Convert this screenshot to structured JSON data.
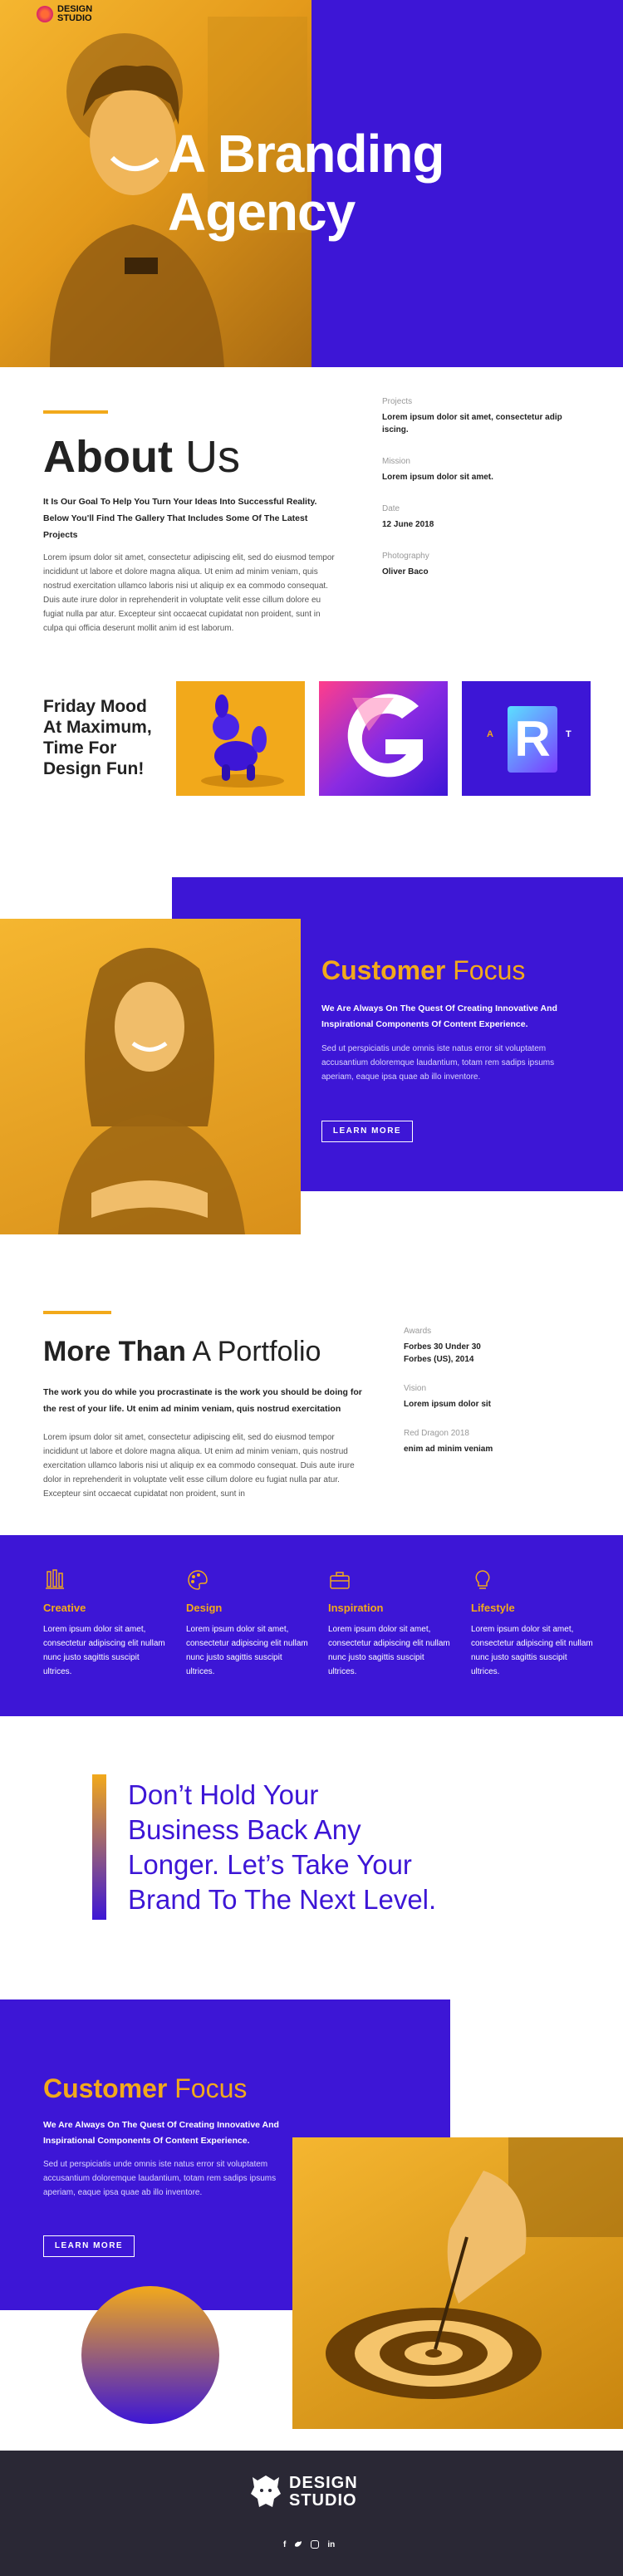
{
  "brand": {
    "name_line1": "DESIGN",
    "name_line2": "STUDIO"
  },
  "hero": {
    "title_line1": "A Branding",
    "title_line2": "Agency"
  },
  "about": {
    "title_bold": "About",
    "title_light": "Us",
    "lead": "It Is Our Goal To Help You Turn Your Ideas Into Successful Reality. Below You'll Find The Gallery That Includes Some Of The Latest Projects",
    "body": "Lorem ipsum dolor sit amet, consectetur adipiscing elit, sed do eiusmod tempor incididunt ut labore et dolore magna aliqua. Ut enim ad minim veniam, quis nostrud exercitation ullamco laboris nisi ut aliquip ex ea commodo consequat. Duis aute irure dolor in reprehenderit in voluptate velit esse cillum dolore eu fugiat nulla par atur. Excepteur sint occaecat cupidatat non proident, sunt in culpa qui officia deserunt mollit anim id est laborum.",
    "meta": [
      {
        "label": "Projects",
        "value": "Lorem ipsum dolor sit amet, consectetur adip iscing."
      },
      {
        "label": "Mission",
        "value": "Lorem ipsum dolor sit amet."
      },
      {
        "label": "Date",
        "value": "12 June 2018"
      },
      {
        "label": "Photography",
        "value": "Oliver Baco"
      }
    ]
  },
  "friday": {
    "text": "Friday Mood At Maximum, Time For Design Fun!",
    "tile_letters": [
      "A",
      "R",
      "T"
    ]
  },
  "customer_focus_1": {
    "title_orange": "Customer",
    "title_light": "Focus",
    "lead": "We Are Always On The Quest Of Creating Innovative And Inspirational Components Of Content Experience.",
    "body": "Sed ut perspiciatis unde omnis iste natus error sit voluptatem accusantium doloremque laudantium, totam rem sadips ipsums aperiam, eaque ipsa quae ab illo inventore.",
    "button": "LEARN MORE"
  },
  "portfolio": {
    "title_bold": "More Than",
    "title_light": "A Portfolio",
    "lead": "The work you do while you procrastinate is the work you should be doing for the rest of your life. Ut enim ad minim veniam, quis nostrud exercitation",
    "body": "Lorem ipsum dolor sit amet, consectetur adipiscing elit, sed do eiusmod tempor incididunt ut labore et dolore magna aliqua. Ut enim ad minim veniam, quis nostrud exercitation ullamco laboris nisi ut aliquip ex ea commodo consequat. Duis aute irure dolor in reprehenderit in voluptate velit esse cillum dolore eu fugiat nulla par atur. Excepteur sint occaecat cupidatat non proident, sunt in",
    "meta": [
      {
        "label": "Awards",
        "value": "Forbes 30 Under 30 Forbes (US), 2014"
      },
      {
        "label": "Vision",
        "value": "Lorem ipsum dolor sit"
      },
      {
        "label": "Red Dragon 2018",
        "value": "enim ad minim veniam"
      }
    ]
  },
  "services": [
    {
      "title": "Creative",
      "text": "Lorem ipsum dolor sit amet, consectetur adipiscing elit nullam nunc justo sagittis suscipit ultrices."
    },
    {
      "title": "Design",
      "text": "Lorem ipsum dolor sit amet, consectetur adipiscing elit nullam nunc justo sagittis suscipit ultrices."
    },
    {
      "title": "Inspiration",
      "text": "Lorem ipsum dolor sit amet, consectetur adipiscing elit nullam nunc justo sagittis suscipit ultrices."
    },
    {
      "title": "Lifestyle",
      "text": "Lorem ipsum dolor sit amet, consectetur adipiscing elit nullam nunc justo sagittis suscipit ultrices."
    }
  ],
  "quote": {
    "line1": "Don’t Hold Your",
    "line2": "Business Back Any",
    "line3": "Longer. Let’s Take Your",
    "line4": "Brand To The Next Level."
  },
  "customer_focus_2": {
    "title_orange": "Customer",
    "title_light": "Focus",
    "lead": "We Are Always On The Quest Of Creating Innovative And Inspirational Components Of Content Experience.",
    "body": "Sed ut perspiciatis unde omnis iste natus error sit voluptatem accusantium doloremque laudantium, totam rem sadips ipsums aperiam, eaque ipsa quae ab illo inventore.",
    "button": "LEARN MORE"
  },
  "footer": {
    "brand_line1": "DESIGN",
    "brand_line2": "STUDIO",
    "social": [
      "f",
      "t",
      "ig",
      "in"
    ]
  },
  "colors": {
    "blue": "#3d16d6",
    "orange": "#f2a91b",
    "footer": "#2a2835"
  }
}
